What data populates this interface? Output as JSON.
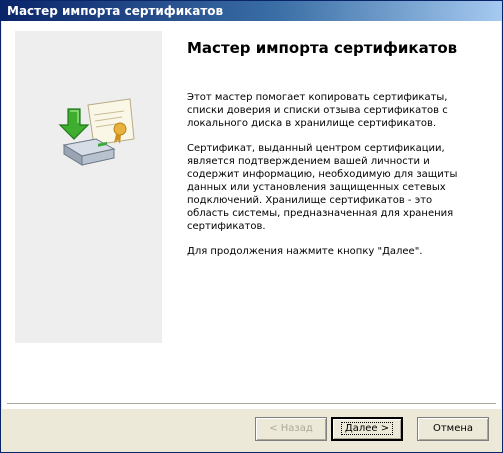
{
  "window": {
    "title": "Мастер импорта сертификатов"
  },
  "content": {
    "heading": "Мастер импорта сертификатов",
    "paragraphs": [
      "Этот мастер помогает копировать сертификаты,\nсписки доверия и списки отзыва сертификатов с\nлокального диска в хранилище сертификатов.",
      "Сертификат, выданный центром сертификации,\nявляется подтверждением вашей личности и\nсодержит информацию, необходимую для защиты\nданных или установления защищенных сетевых\nподключений. Хранилище сертификатов - это\nобласть системы, предназначенная для хранения\nсертификатов.",
      "Для продолжения нажмите кнопку \"Далее\"."
    ]
  },
  "buttons": {
    "back": "< Назад",
    "next": "Далее >",
    "cancel": "Отмена"
  },
  "icons": {
    "wizard_art": "certificate-import-icon"
  },
  "colors": {
    "titlebar_start": "#0a246a",
    "titlebar_end": "#a6caf0",
    "dialog_bg": "#ece9d8",
    "body_bg": "#ffffff",
    "side_panel_bg": "#eeeeee"
  }
}
